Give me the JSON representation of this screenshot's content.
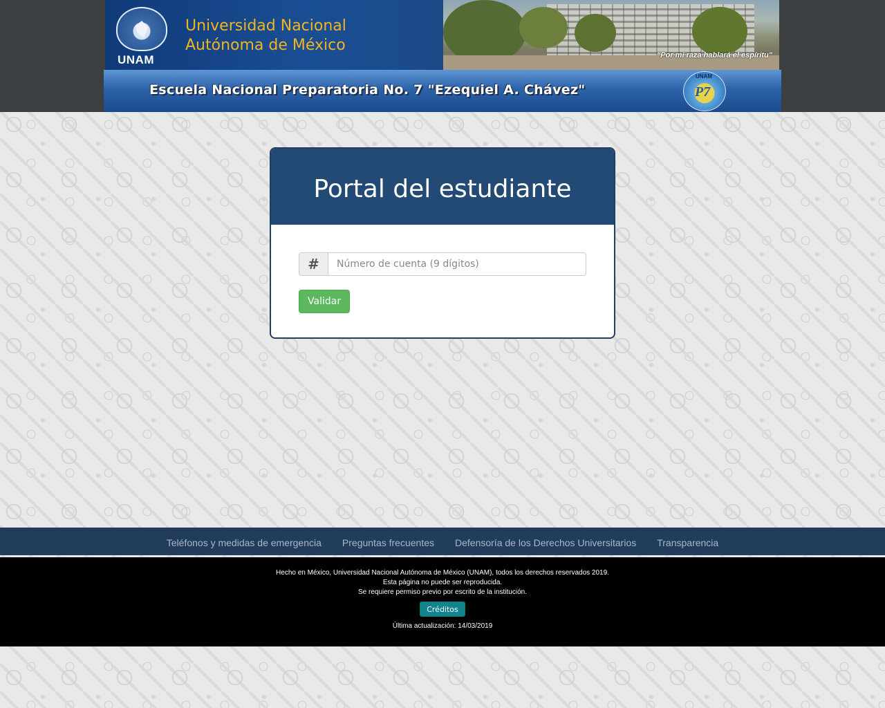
{
  "header": {
    "unam_acronym": "UNAM",
    "unam_name_line1": "Universidad Nacional",
    "unam_name_line2": "Autónoma de México",
    "motto": "\"Por mi raza hablará el espíritu\"",
    "school_title": "Escuela Nacional Preparatoria No. 7 \"Ezequiel A. Chávez\"",
    "p7_logo_top": "UNAM",
    "p7_logo_text": "P7",
    "colors": {
      "banner_blue": "#1a4e94",
      "unam_gold": "#f2b51e"
    }
  },
  "portal": {
    "title": "Portal del estudiante",
    "input_icon": "hash-icon",
    "input_icon_glyph": "#",
    "account_placeholder": "Número de cuenta (9 dígitos)",
    "account_value": "",
    "validate_label": "Validar",
    "colors": {
      "header": "#224a74",
      "button": "#5cb85c"
    }
  },
  "footer": {
    "links": [
      "Teléfonos y medidas de emergencia",
      "Preguntas frecuentes",
      "Defensoría de los Derechos Universitarios",
      "Transparencia"
    ],
    "legal_line1": "Hecho en México, Universidad Nacional Autónoma de México (UNAM), todos los derechos reservados 2019.",
    "legal_line2": "Esta página no puede ser reproducida.",
    "legal_line3": "Se requiere permiso previo por escrito de la institución.",
    "credits_label": "Créditos",
    "last_update": "Última actualización: 14/03/2019"
  }
}
